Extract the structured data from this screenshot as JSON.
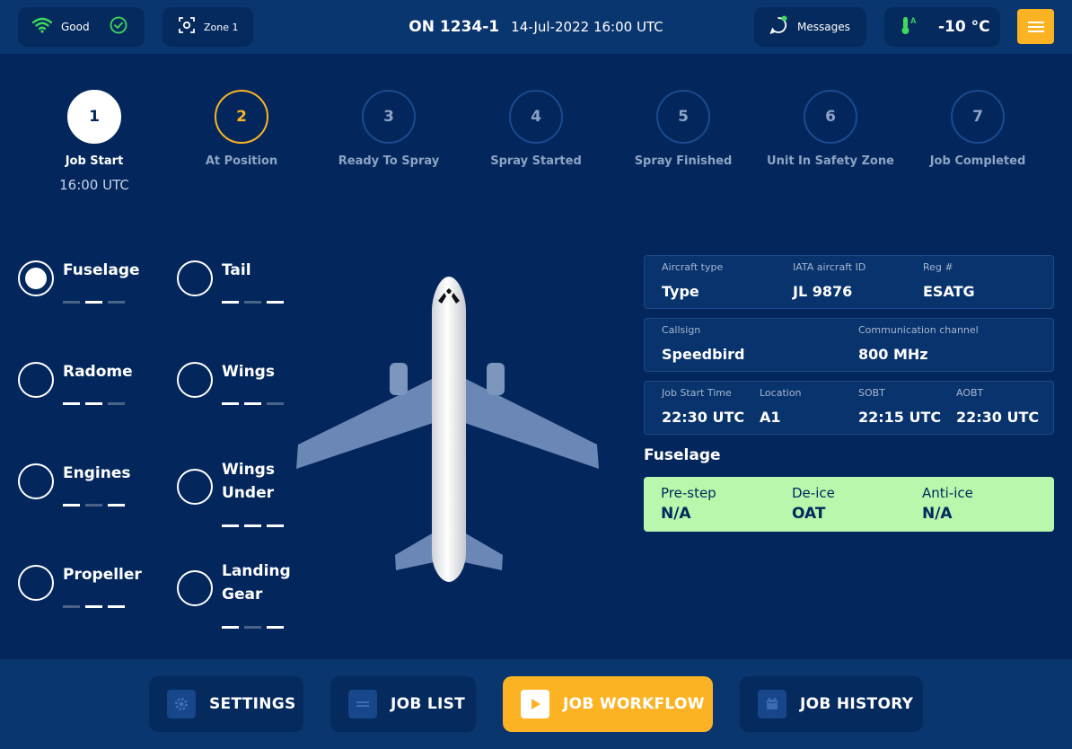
{
  "header": {
    "signal_label": "Good",
    "zone_label": "Zone 1",
    "flight_number": "ON 1234-1",
    "datetime": "14-Jul-2022 16:00 UTC",
    "messages_label": "Messages",
    "temperature": "-10 °C",
    "icons": {
      "wifi": "wifi-icon",
      "check": "check-circle-icon",
      "zone": "focus-icon",
      "messages": "chat-icon",
      "temperature": "thermometer-icon",
      "menu": "hamburger-icon"
    }
  },
  "steps": [
    {
      "num": "1",
      "label": "Job Start",
      "time": "16:00 UTC",
      "state": "done"
    },
    {
      "num": "2",
      "label": "At Position",
      "state": "active"
    },
    {
      "num": "3",
      "label": "Ready To Spray",
      "state": "pending"
    },
    {
      "num": "4",
      "label": "Spray Started",
      "state": "pending"
    },
    {
      "num": "5",
      "label": "Spray Finished",
      "state": "pending"
    },
    {
      "num": "6",
      "label": "Unit In Safety Zone",
      "state": "pending"
    },
    {
      "num": "7",
      "label": "Job Completed",
      "state": "pending"
    }
  ],
  "zones": [
    {
      "name": "Fuselage",
      "selected": true,
      "bars": [
        0,
        1,
        0
      ]
    },
    {
      "name": "Tail",
      "selected": false,
      "bars": [
        1,
        0,
        1
      ]
    },
    {
      "name": "Radome",
      "selected": false,
      "bars": [
        1,
        1,
        0
      ]
    },
    {
      "name": "Wings",
      "selected": false,
      "bars": [
        1,
        1,
        0
      ]
    },
    {
      "name": "Engines",
      "selected": false,
      "bars": [
        1,
        0,
        1
      ]
    },
    {
      "name": "Wings Under",
      "selected": false,
      "bars": [
        1,
        1,
        1
      ]
    },
    {
      "name": "Propeller",
      "selected": false,
      "bars": [
        0,
        1,
        1
      ]
    },
    {
      "name": "Landing Gear",
      "selected": false,
      "bars": [
        1,
        0,
        1
      ]
    }
  ],
  "aircraft": {
    "type_label": "Aircraft type",
    "type_value": "Type",
    "iata_label": "IATA aircraft ID",
    "iata_value": "JL 9876",
    "reg_label": "Reg #",
    "reg_value": "ESATG",
    "callsign_label": "Callsign",
    "callsign_value": "Speedbird",
    "channel_label": "Communication channel",
    "channel_value": "800 MHz",
    "jobstart_label": "Job Start Time",
    "jobstart_value": "22:30 UTC",
    "location_label": "Location",
    "location_value": "A1",
    "sobt_label": "SOBT",
    "sobt_value": "22:15 UTC",
    "aobt_label": "AOBT",
    "aobt_value": "22:30 UTC"
  },
  "fluid": {
    "title": "Fuselage",
    "prestep_label": "Pre-step",
    "prestep_value": "N/A",
    "deice_label": "De-ice",
    "deice_value": "OAT",
    "antiice_label": "Anti-ice",
    "antiice_value": "N/A"
  },
  "nav": {
    "settings": "SETTINGS",
    "job_list": "JOB LIST",
    "job_workflow": "JOB WORKFLOW",
    "job_history": "JOB HISTORY",
    "active": "job_workflow",
    "icons": [
      "gear-icon",
      "list-icon",
      "play-icon",
      "calendar-icon"
    ]
  },
  "colors": {
    "background": "#03275c",
    "accent": "#fbb324",
    "success": "#b8f7ac",
    "signal": "#3ddc5c"
  }
}
